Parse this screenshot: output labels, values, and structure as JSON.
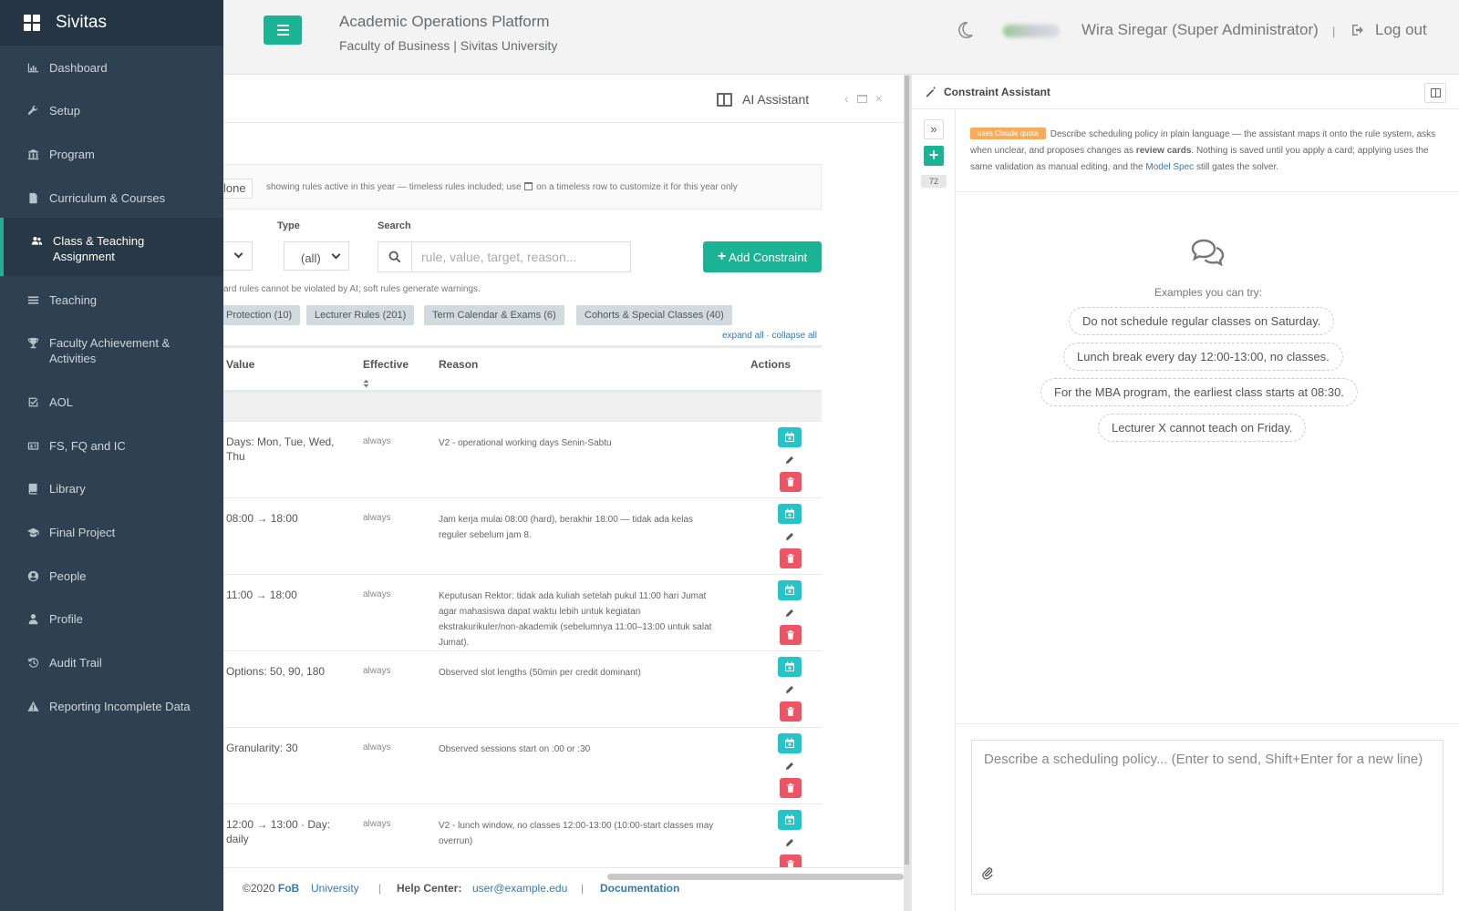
{
  "sidebar": {
    "brand": "Sivitas",
    "items": [
      {
        "label": "Dashboard",
        "icon": "bar-chart-icon"
      },
      {
        "label": "Setup",
        "icon": "wrench-icon"
      },
      {
        "label": "Program",
        "icon": "institution-icon"
      },
      {
        "label": "Curriculum & Courses",
        "icon": "document-icon"
      },
      {
        "label": "Class & Teaching Assignment",
        "icon": "users-icon"
      },
      {
        "label": "Teaching",
        "icon": "list-icon"
      },
      {
        "label": "Faculty Achievement & Activities",
        "icon": "trophy-icon"
      },
      {
        "label": "AOL",
        "icon": "check-square-icon"
      },
      {
        "label": "FS, FQ and IC",
        "icon": "id-card-icon"
      },
      {
        "label": "Library",
        "icon": "book-icon"
      },
      {
        "label": "Final Project",
        "icon": "graduation-cap-icon"
      },
      {
        "label": "People",
        "icon": "user-circle-icon"
      },
      {
        "label": "Profile",
        "icon": "user-icon"
      },
      {
        "label": "Audit Trail",
        "icon": "history-icon"
      },
      {
        "label": "Reporting Incomplete Data",
        "icon": "warning-icon"
      }
    ]
  },
  "header": {
    "title": "Academic Operations Platform",
    "subtitle": "Faculty of Business | Sivitas University",
    "user": "Wira Siregar (Super Administrator)",
    "separator": "|",
    "logout": "Log out"
  },
  "panel": {
    "ai_assistant": "AI Assistant",
    "none_button": "lone",
    "info_text_before": "showing rules active in this year — timeless rules included; use",
    "info_text_after": "on a timeless row to customize it for this year only",
    "type_label": "Type",
    "type_value": "(all)",
    "search_label": "Search",
    "search_placeholder": "rule, value, target, reason...",
    "add_button": "Add Constraint",
    "hint": "ard rules cannot be violated by AI; soft rules generate warnings.",
    "chips": [
      "Protection (10)",
      "Lecturer Rules (201)",
      "Term Calendar & Exams (6)",
      "Cohorts & Special Classes (40)"
    ],
    "expand_collapse": "expand all · collapse all",
    "columns": [
      "Value",
      "Effective",
      "Reason",
      "Actions"
    ],
    "rows": [
      {
        "value": "Days: Mon, Tue, Wed, Thu",
        "effective": "always",
        "reason": "V2 - operational working days Senin-Sabtu"
      },
      {
        "value": "08:00 → 18:00",
        "effective": "always",
        "reason": "Jam kerja mulai 08:00 (hard), berakhir 18:00 — tidak ada kelas reguler sebelum jam 8."
      },
      {
        "value": "11:00 → 18:00",
        "effective": "always",
        "reason": "Keputusan Rektor: tidak ada kuliah setelah pukul 11:00 hari Jumat agar mahasiswa dapat waktu lebih untuk kegiatan ekstrakurikuler/non-akademik (sebelumnya 11:00–13:00 untuk salat Jumat)."
      },
      {
        "value": "Options: 50, 90, 180",
        "effective": "always",
        "reason": "Observed slot lengths (50min per credit dominant)"
      },
      {
        "value": "Granularity: 30",
        "effective": "always",
        "reason": "Observed sessions start on :00 or :30"
      },
      {
        "value": "12:00 → 13:00 · Day: daily",
        "effective": "always",
        "reason": "V2 - lunch window, no classes 12:00-13:00 (10:00-start classes may overrun)"
      }
    ]
  },
  "footer": {
    "copyright": "©2020",
    "fob": "FoB",
    "university": "University",
    "sep": "|",
    "help_label": "Help Center:",
    "help_email": "user@example.edu",
    "documentation": "Documentation"
  },
  "assistant": {
    "title": "Constraint Assistant",
    "count": "72",
    "quota_badge": "uses Claude quota",
    "desc_1": "Describe scheduling policy in plain language — the assistant maps it onto the rule system, asks when unclear, and proposes changes as",
    "desc_bold": "review cards",
    "desc_2": ". Nothing is saved until you apply a card; applying uses the same validation as manual editing, and the",
    "desc_link": "Model Spec",
    "desc_3": "still gates the solver.",
    "examples_label": "Examples you can try:",
    "examples": [
      "Do not schedule regular classes on Saturday.",
      "Lunch break every day 12:00-13:00, no classes.",
      "For the MBA program, the earliest class starts at 08:30.",
      "Lecturer X cannot teach on Friday."
    ],
    "input_placeholder": "Describe a scheduling policy... (Enter to send, Shift+Enter for a new line)"
  },
  "colors": {
    "sidebar": "#2f4050",
    "accent": "#1ab394",
    "info": "#23c6c8",
    "danger": "#ed5565",
    "warning": "#f8ac59",
    "link": "#337ab7"
  }
}
